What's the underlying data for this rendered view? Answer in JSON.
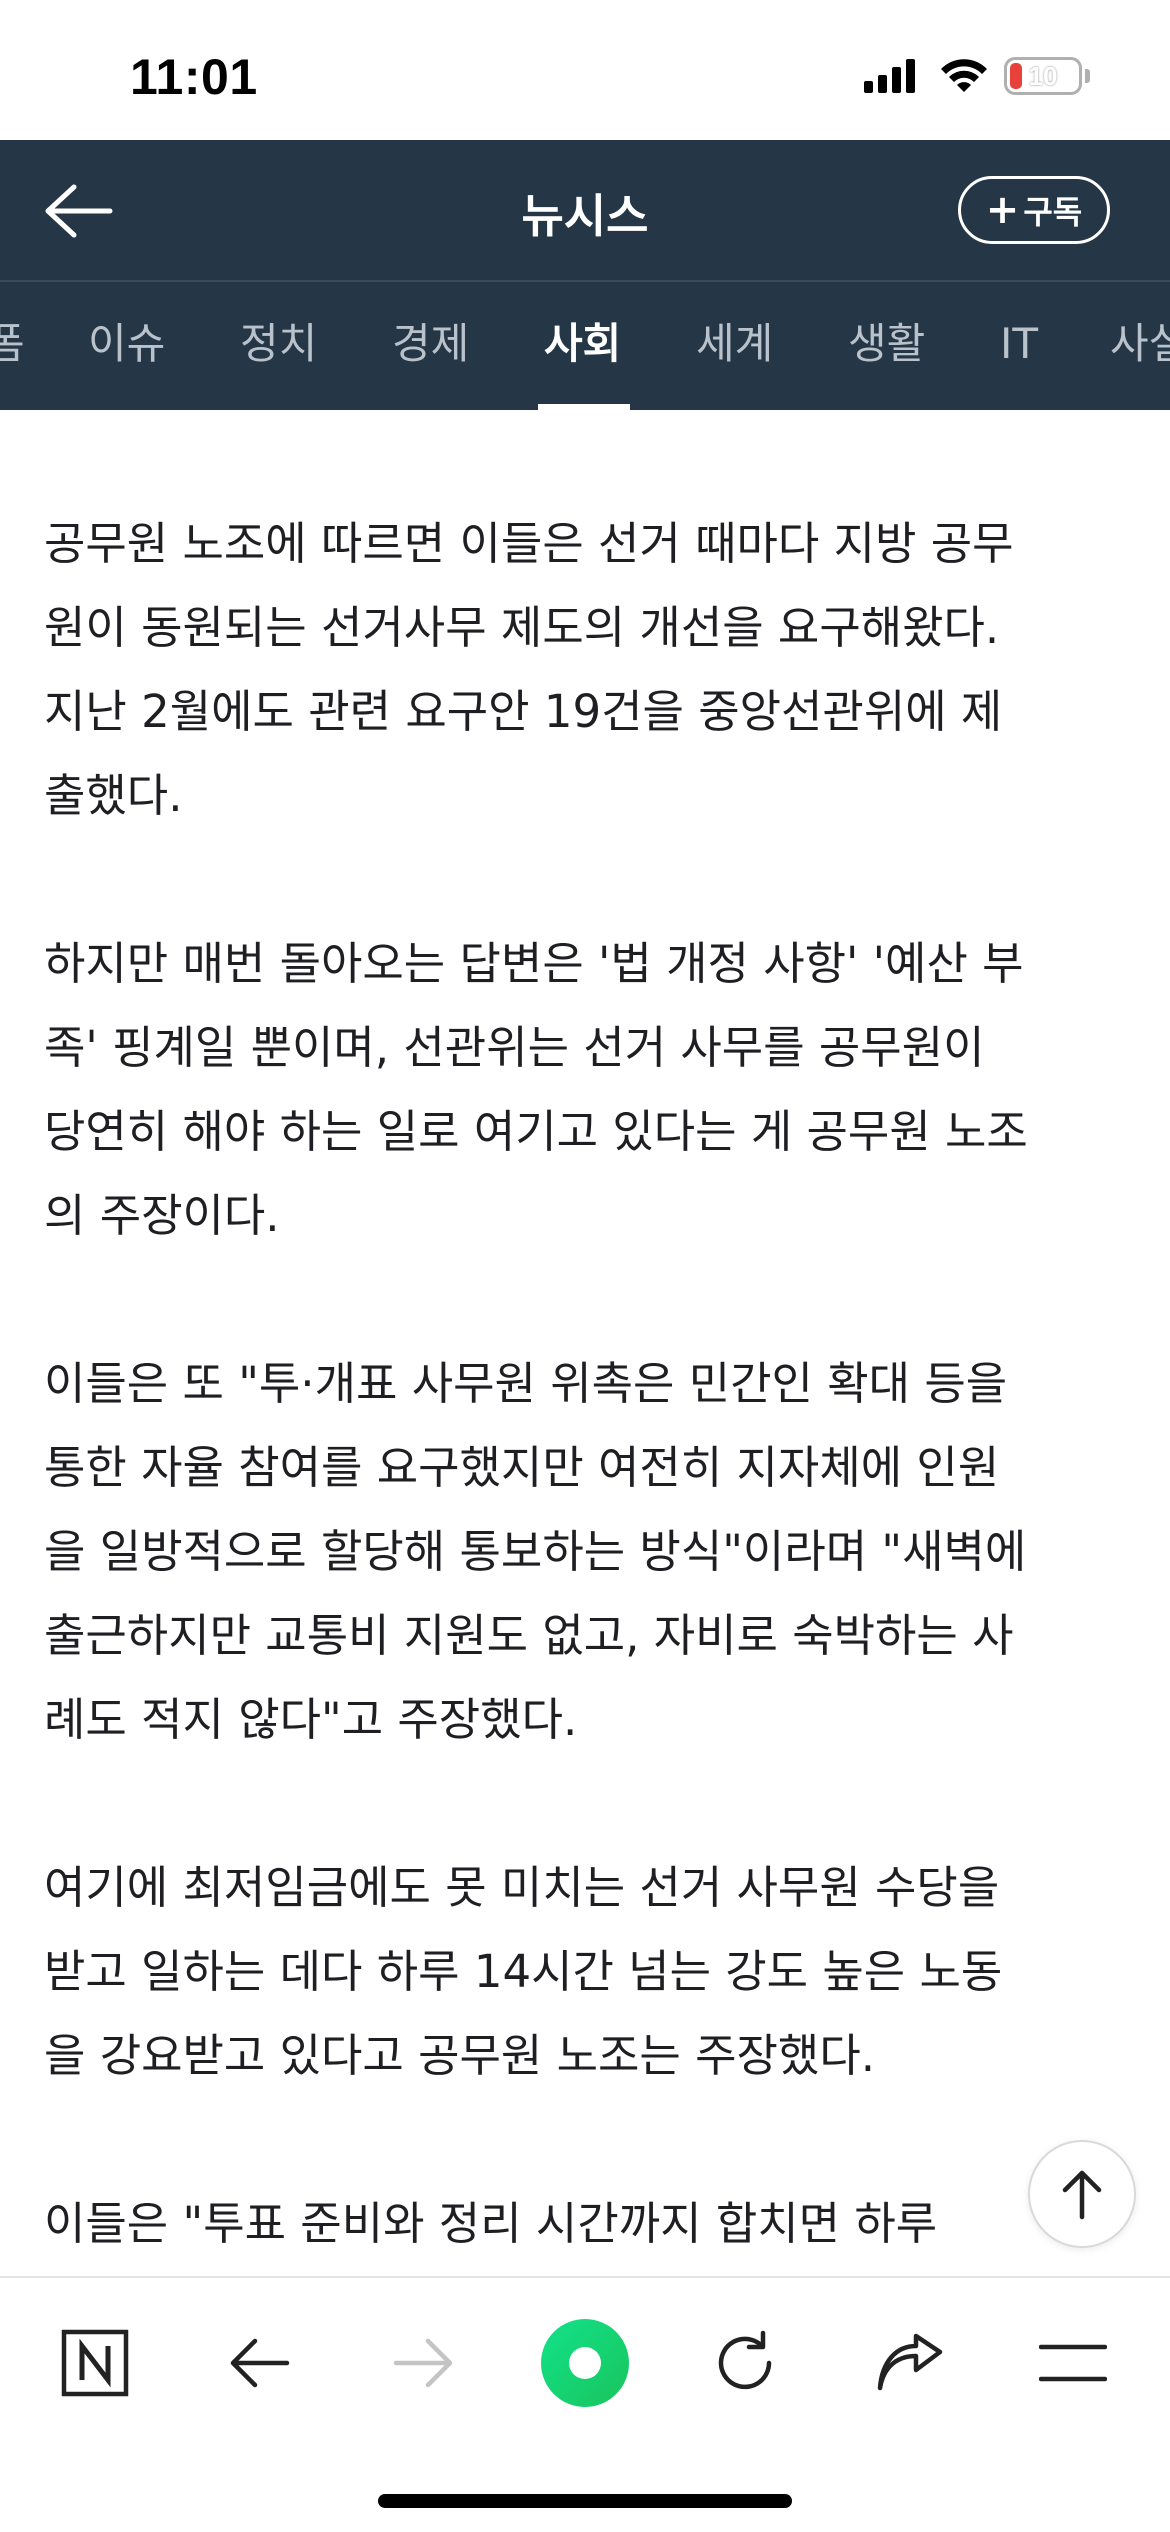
{
  "status_bar": {
    "time": "11:01",
    "battery": "10",
    "icons": [
      "cellular-signal-icon",
      "wifi-icon",
      "battery-charging-icon"
    ]
  },
  "header": {
    "title": "뉴시스",
    "subscribe_label": "구독",
    "back_icon": "back-arrow-icon",
    "background": "#253746"
  },
  "tabs": [
    {
      "label": "폼",
      "active": false
    },
    {
      "label": "이슈",
      "active": false
    },
    {
      "label": "정치",
      "active": false
    },
    {
      "label": "경제",
      "active": false
    },
    {
      "label": "사회",
      "active": true
    },
    {
      "label": "세계",
      "active": false
    },
    {
      "label": "생활",
      "active": false
    },
    {
      "label": "IT",
      "active": false
    },
    {
      "label": "사설",
      "active": false
    }
  ],
  "article": {
    "paragraphs": [
      "공무원 노조에 따르면 이들은 선거 때마다 지방 공무\n원이 동원되는 선거사무 제도의 개선을 요구해왔다.\n지난 2월에도 관련 요구안 19건을 중앙선관위에 제\n출했다.",
      "하지만 매번 돌아오는 답변은 '법 개정 사항' '예산 부\n족' 핑계일 뿐이며, 선관위는 선거 사무를 공무원이\n당연히 해야 하는 일로 여기고 있다는 게 공무원 노조\n의 주장이다.",
      "이들은 또 \"투·개표 사무원 위촉은 민간인 확대 등을\n통한 자율 참여를 요구했지만 여전히 지자체에 인원\n을 일방적으로 할당해 통보하는 방식\"이라며 \"새벽에\n출근하지만 교통비 지원도 없고, 자비로 숙박하는 사\n례도 적지 않다\"고 주장했다.",
      "여기에 최저임금에도 못 미치는 선거 사무원 수당을\n받고 일하는 데다 하루 14시간 넘는 강도 높은 노동\n을 강요받고 있다고 공무원 노조는 주장했다.",
      "이들은 \"투표 준비와 정리 시간까지 합치면 하루"
    ]
  },
  "bottom_nav": [
    {
      "name": "naver-home-icon"
    },
    {
      "name": "back-icon"
    },
    {
      "name": "forward-icon",
      "disabled": true
    },
    {
      "name": "green-dot-icon"
    },
    {
      "name": "refresh-icon"
    },
    {
      "name": "share-icon"
    },
    {
      "name": "menu-icon"
    }
  ],
  "colors": {
    "header": "#253746",
    "accent_green": "#19d26e",
    "text": "#1e1e23"
  }
}
